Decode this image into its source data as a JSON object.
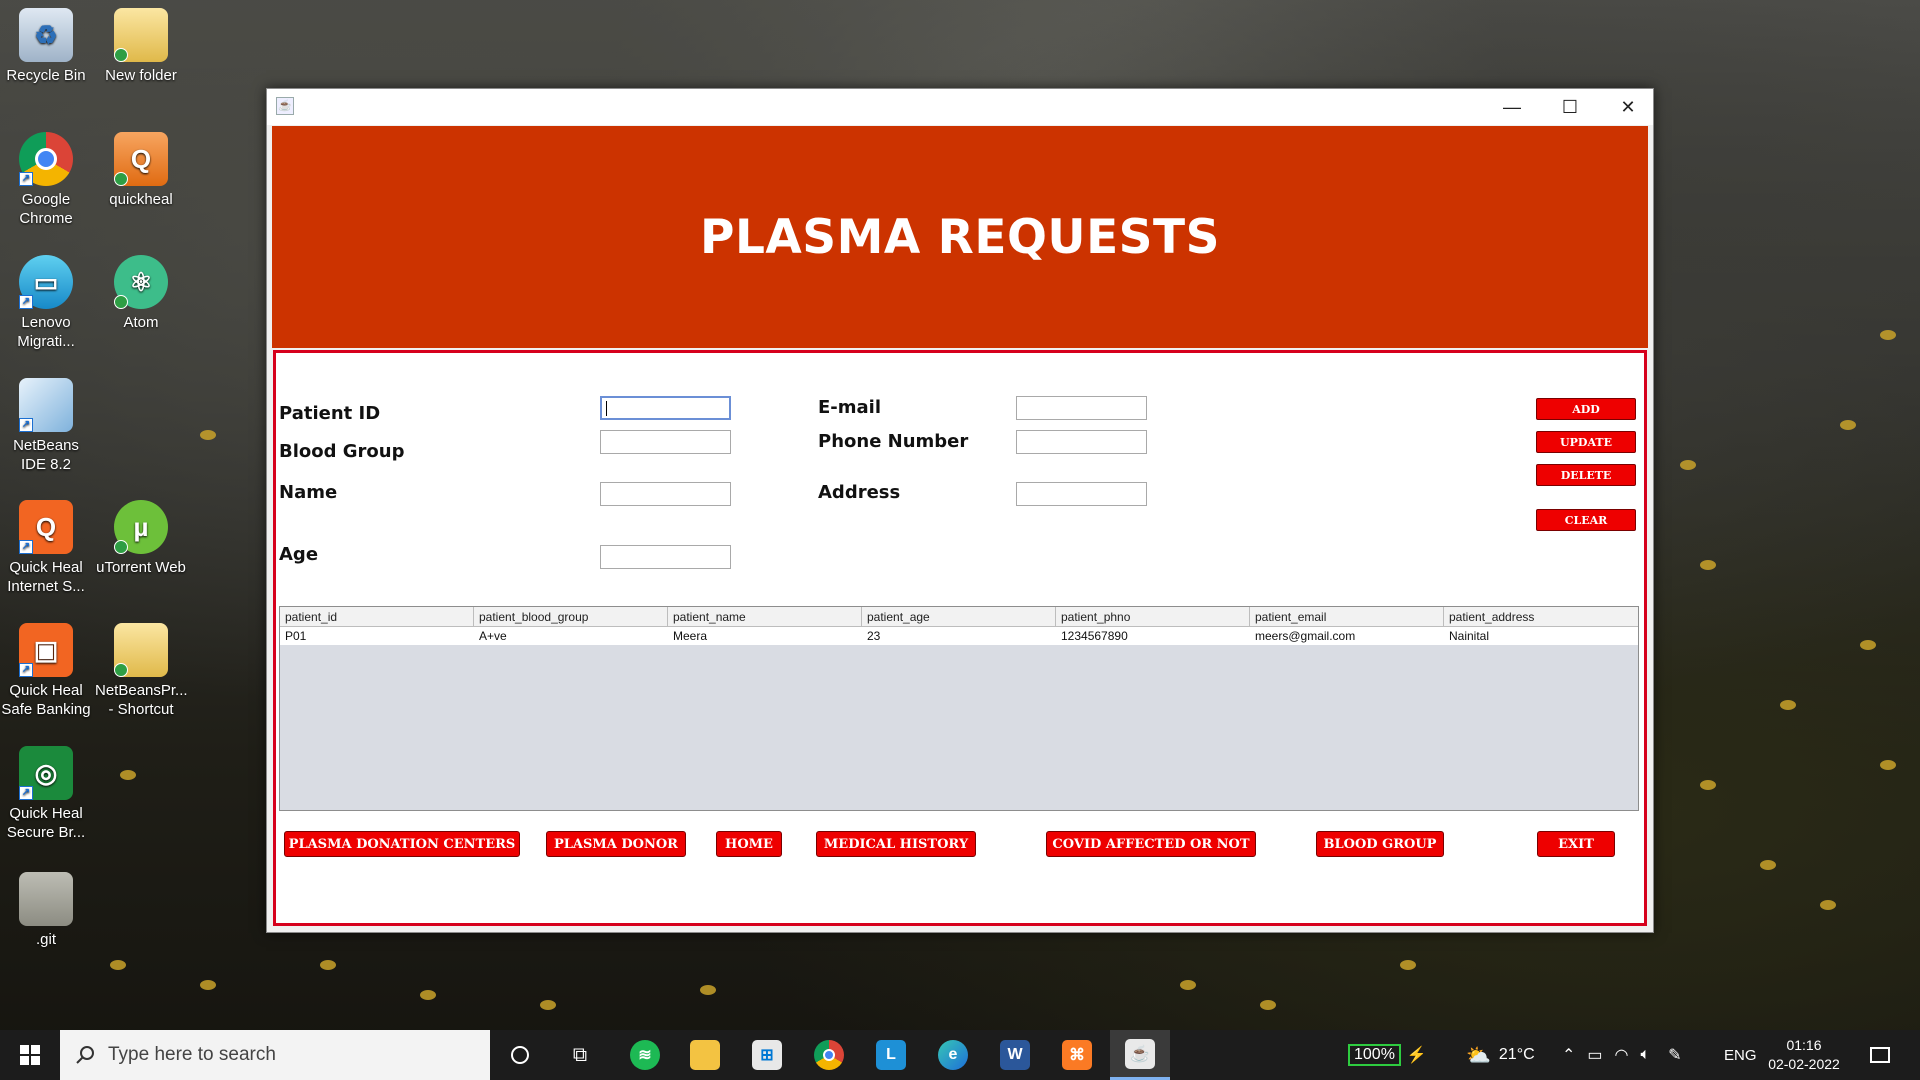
{
  "desktop": {
    "icons": [
      {
        "label": "Recycle Bin"
      },
      {
        "label": "New folder"
      },
      {
        "label": "Google Chrome"
      },
      {
        "label": "quickheal"
      },
      {
        "label": "Lenovo Migrati..."
      },
      {
        "label": "Atom"
      },
      {
        "label": "NetBeans IDE 8.2"
      },
      {
        "label": "Quick Heal Internet S..."
      },
      {
        "label": "uTorrent Web"
      },
      {
        "label": "Quick Heal Safe Banking"
      },
      {
        "label": "NetBeansPr... - Shortcut"
      },
      {
        "label": "Quick Heal Secure Br..."
      },
      {
        "label": ".git"
      }
    ]
  },
  "window": {
    "title": "",
    "controls": {
      "minimize": "—",
      "maximize": "☐",
      "close": "✕"
    }
  },
  "header": {
    "title": "PLASMA REQUESTS"
  },
  "form": {
    "labels": {
      "patient_id": "Patient ID",
      "blood_group": "Blood Group",
      "name": "Name",
      "age": "Age",
      "email": "E-mail",
      "phone": "Phone Number",
      "address": "Address"
    },
    "values": {
      "patient_id": "",
      "blood_group": "",
      "name": "",
      "age": "",
      "email": "",
      "phone": "",
      "address": ""
    }
  },
  "side_buttons": {
    "add": "ADD",
    "update": "UPDATE",
    "delete": "DELETE",
    "clear": "CLEAR"
  },
  "table": {
    "columns": [
      "patient_id",
      "patient_blood_group",
      "patient_name",
      "patient_age",
      "patient_phno",
      "patient_email",
      "patient_address"
    ],
    "rows": [
      [
        "P01",
        "A+ve",
        "Meera",
        "23",
        "1234567890",
        "meers@gmail.com",
        "Nainital"
      ]
    ]
  },
  "bottom_buttons": {
    "centers": "PLASMA DONATION CENTERS",
    "donor": "PLASMA DONOR",
    "home": "HOME",
    "history": "MEDICAL HISTORY",
    "covid": "COVID AFFECTED OR NOT",
    "blood": "BLOOD GROUP",
    "exit": "EXIT"
  },
  "taskbar": {
    "search_placeholder": "Type here to search",
    "battery": "100%",
    "temperature": "21°C",
    "language": "ENG",
    "time": "01:16",
    "date": "02-02-2022"
  },
  "colors": {
    "header": "#cc3300",
    "button": "#ee0000",
    "panel_border": "#d6001c"
  }
}
